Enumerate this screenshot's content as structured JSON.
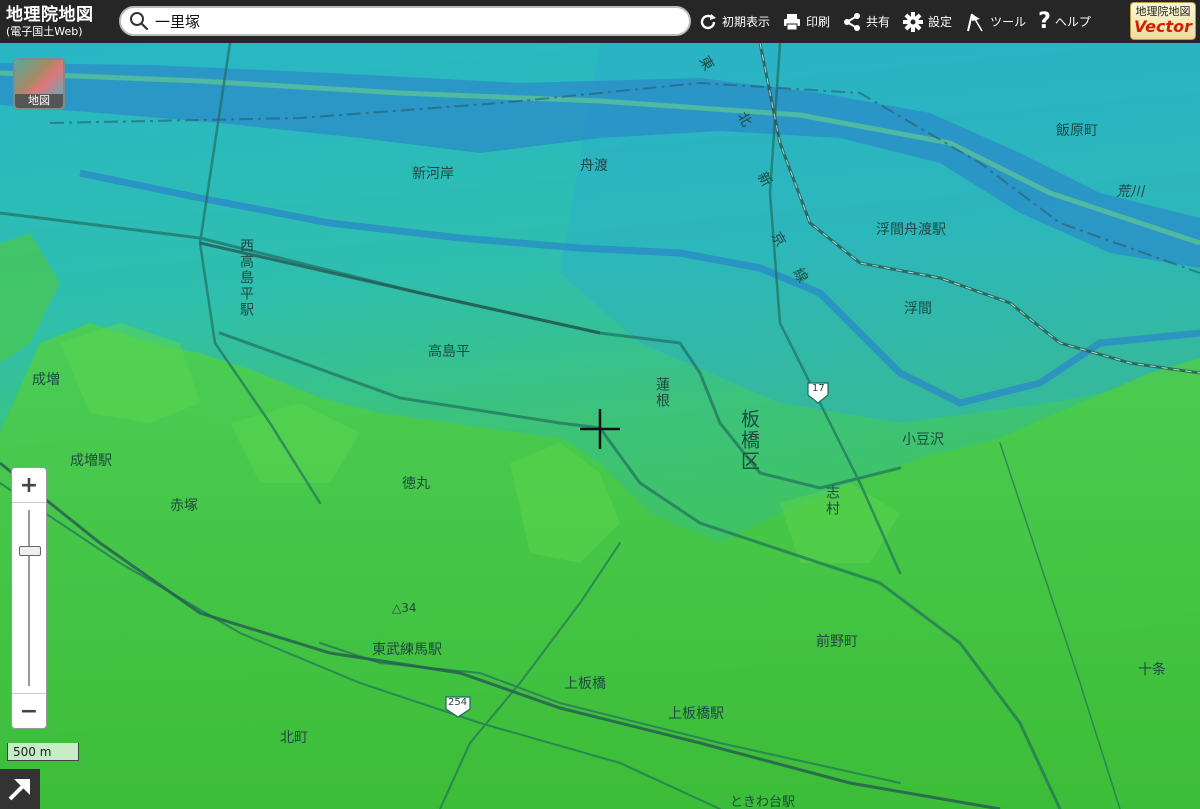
{
  "header": {
    "logo_main": "地理院地図",
    "logo_sub": "(電子国土Web)",
    "search_value": "一里塚",
    "tools": {
      "reset": "初期表示",
      "print": "印刷",
      "share": "共有",
      "settings": "設定",
      "tool": "ツール",
      "help": "ヘルプ"
    },
    "vector_line1": "地理院地図",
    "vector_line2": "Vector"
  },
  "map": {
    "layer_button": "地図",
    "scale": "500 m",
    "labels": {
      "shingashi": "新河岸",
      "funado": "舟渡",
      "shin": "新",
      "azusawa": "東",
      "kita": "北",
      "sen": "線",
      "kyo": "京",
      "iiharacho": "飯原町",
      "arakawa": "荒川",
      "ukimafunado": "浮間舟渡駅",
      "ukima": "浮間",
      "nishitakashimadaira": "西高島平駅",
      "takashimadaira": "高島平",
      "narimasu": "成増",
      "narimasueki": "成増駅",
      "akatsuka": "赤塚",
      "tokumaru": "徳丸",
      "hasune": "蓮根",
      "itabashiku": "板橋区",
      "azusawa2": "小豆沢",
      "shimura": "志村",
      "maenocho": "前野町",
      "tobunerima": "東武練馬駅",
      "kamiitabashi": "上板橋",
      "kamiitabashieki": "上板橋駅",
      "kitamachi": "北町",
      "jujo": "十条",
      "tokiwadai": "ときわ台駅",
      "elev": "△34",
      "route17": "17",
      "route254": "254"
    }
  }
}
